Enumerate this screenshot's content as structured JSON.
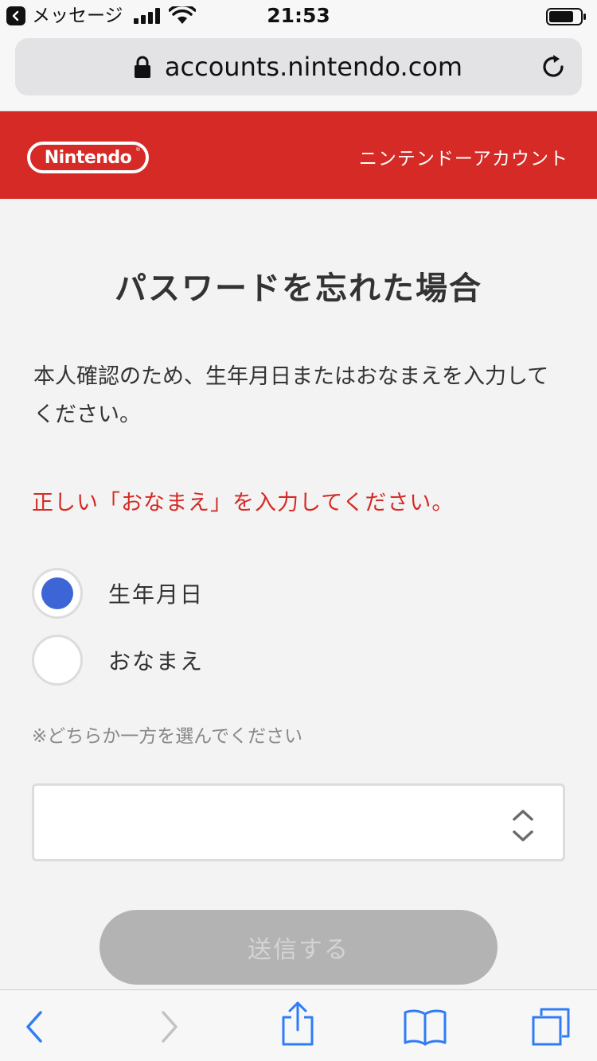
{
  "status_bar": {
    "back_app_label": "メッセージ",
    "time": "21:53"
  },
  "browser": {
    "url": "accounts.nintendo.com"
  },
  "header": {
    "logo_text": "Nintendo",
    "account_label": "ニンテンドーアカウント"
  },
  "main": {
    "title": "パスワードを忘れた場合",
    "intro": "本人確認のため、生年月日またはおなまえを入力してください。",
    "error": "正しい「おなまえ」を入力してください。",
    "options": [
      {
        "label": "生年月日",
        "selected": true
      },
      {
        "label": "おなまえ",
        "selected": false
      }
    ],
    "note": "※どちらか一方を選んでください",
    "select_value": "",
    "submit_label": "送信する"
  },
  "colors": {
    "brand_red": "#d52a25",
    "radio_selected": "#3e65d6",
    "ios_blue": "#2f7cf6",
    "button_disabled": "#b3b3b3"
  }
}
